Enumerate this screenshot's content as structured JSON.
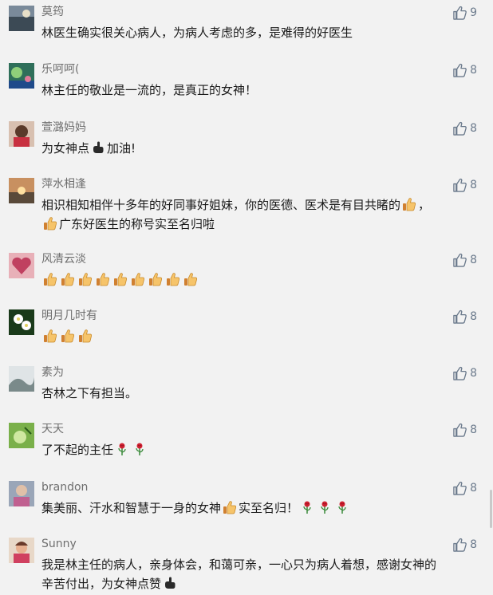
{
  "comments": [
    {
      "name": "莫筠",
      "likes": "9",
      "lines": [
        [
          {
            "t": "林医生确实很关心病人，为病人考虑的多，是难得的好医生"
          }
        ]
      ]
    },
    {
      "name": "乐呵呵(",
      "likes": "8",
      "lines": [
        [
          {
            "t": "林主任的敬业是一流的，是真正的女神！"
          }
        ]
      ]
    },
    {
      "name": "萱潞妈妈",
      "likes": "8",
      "lines": [
        [
          {
            "t": "为女神点"
          },
          {
            "e": "point-icon"
          },
          {
            "t": "加油!"
          }
        ]
      ]
    },
    {
      "name": "萍水相逢",
      "likes": "8",
      "lines": [
        [
          {
            "t": "相识相知相伴十多年的好同事好姐妹，你的医德、医术是有目共睹的"
          },
          {
            "e": "thumbs-up-emoji"
          },
          {
            "t": "，"
          }
        ],
        [
          {
            "e": "thumbs-up-emoji"
          },
          {
            "t": "广东好医生的称号实至名归啦"
          }
        ]
      ]
    },
    {
      "name": "风清云淡",
      "likes": "8",
      "lines": [
        [
          {
            "e": "thumbs-up-emoji"
          },
          {
            "e": "thumbs-up-emoji"
          },
          {
            "e": "thumbs-up-emoji"
          },
          {
            "e": "thumbs-up-emoji"
          },
          {
            "e": "thumbs-up-emoji"
          },
          {
            "e": "thumbs-up-emoji"
          },
          {
            "e": "thumbs-up-emoji"
          },
          {
            "e": "thumbs-up-emoji"
          },
          {
            "e": "thumbs-up-emoji"
          }
        ]
      ]
    },
    {
      "name": "明月几时有",
      "likes": "8",
      "lines": [
        [
          {
            "e": "thumbs-up-emoji"
          },
          {
            "e": "thumbs-up-emoji"
          },
          {
            "e": "thumbs-up-emoji"
          }
        ]
      ]
    },
    {
      "name": "素为",
      "likes": "8",
      "lines": [
        [
          {
            "t": "杏林之下有担当。"
          }
        ]
      ]
    },
    {
      "name": "天天",
      "likes": "8",
      "lines": [
        [
          {
            "t": "了不起的主任"
          },
          {
            "e": "rose-emoji"
          },
          {
            "e": "rose-emoji"
          }
        ]
      ]
    },
    {
      "name": "brandon",
      "likes": "8",
      "lines": [
        [
          {
            "t": "集美丽、汗水和智慧于一身的女神"
          },
          {
            "e": "thumbs-up-emoji"
          },
          {
            "t": "实至名归！"
          },
          {
            "e": "rose-emoji"
          },
          {
            "e": "rose-emoji"
          },
          {
            "e": "rose-emoji"
          }
        ]
      ]
    },
    {
      "name": "Sunny",
      "likes": "8",
      "lines": [
        [
          {
            "t": "我是林主任的病人，亲身体会，和蔼可亲，一心只为病人着想，感谢女神的"
          }
        ],
        [
          {
            "t": "辛苦付出，为女神点赞"
          },
          {
            "e": "point-icon"
          }
        ]
      ]
    }
  ],
  "colors": {
    "background": "#f2f2f2",
    "name": "#6e6e6e",
    "text": "#1a1a1a",
    "like": "#6b7a8c"
  }
}
